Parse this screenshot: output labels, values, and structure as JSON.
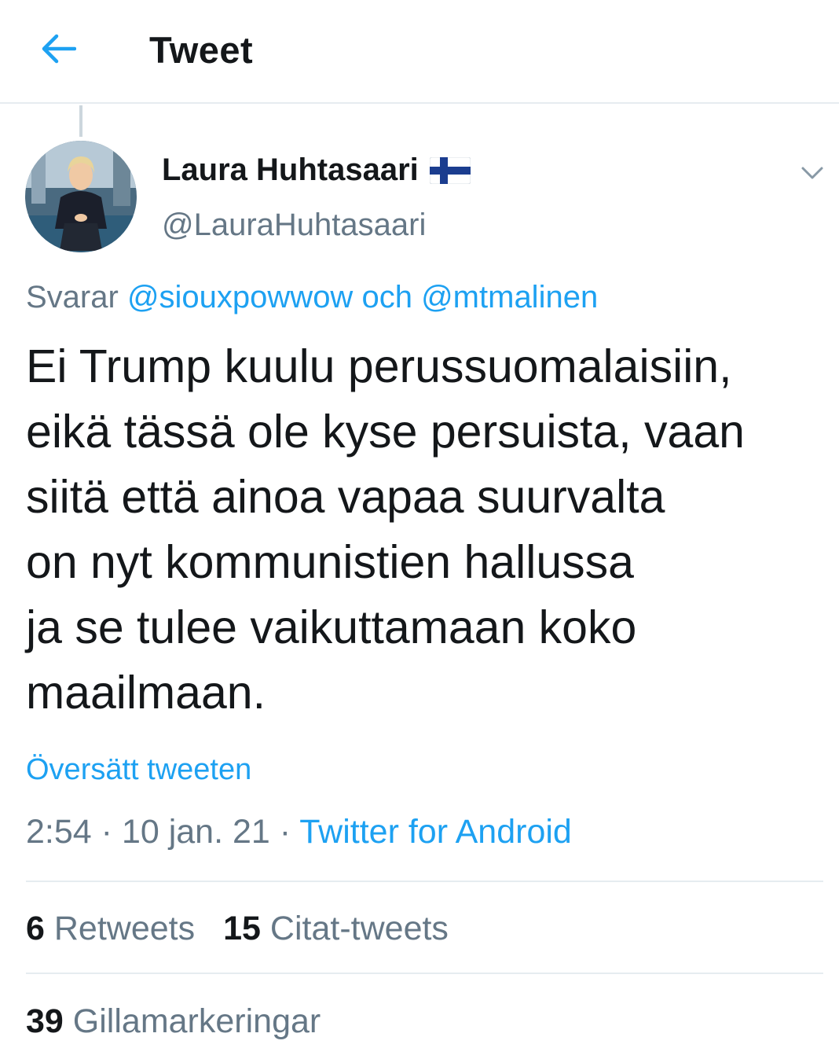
{
  "header": {
    "title": "Tweet",
    "back_icon": "arrow-left-icon"
  },
  "author": {
    "display_name": "Laura Huhtasaari",
    "flag_icon": "finland-flag-icon",
    "handle": "@LauraHuhtasaari"
  },
  "reply": {
    "prefix": "Svarar",
    "mention_1": "@siouxpowwow",
    "conjunction": "och",
    "mention_2": "@mtmalinen"
  },
  "tweet": {
    "lines": [
      "Ei Trump kuulu perussuomalaisiin,",
      "eikä tässä ole kyse persuista, vaan",
      "siitä että ainoa vapaa suurvalta",
      "on nyt kommunistien hallussa",
      "ja se tulee vaikuttamaan koko",
      "maailmaan."
    ],
    "translate_label": "Översätt tweeten"
  },
  "meta": {
    "time": "2:54",
    "separator": "·",
    "date": "10 jan. 21",
    "source": "Twitter for Android"
  },
  "stats": {
    "retweets_count": "6",
    "retweets_label": "Retweets",
    "quotes_count": "15",
    "quotes_label": "Citat-tweets",
    "likes_count": "39",
    "likes_label": "Gillamarkeringar"
  },
  "colors": {
    "accent": "#1da1f2",
    "secondary_text": "#657786",
    "primary_text": "#14171a",
    "divider": "#e6ecf0"
  }
}
